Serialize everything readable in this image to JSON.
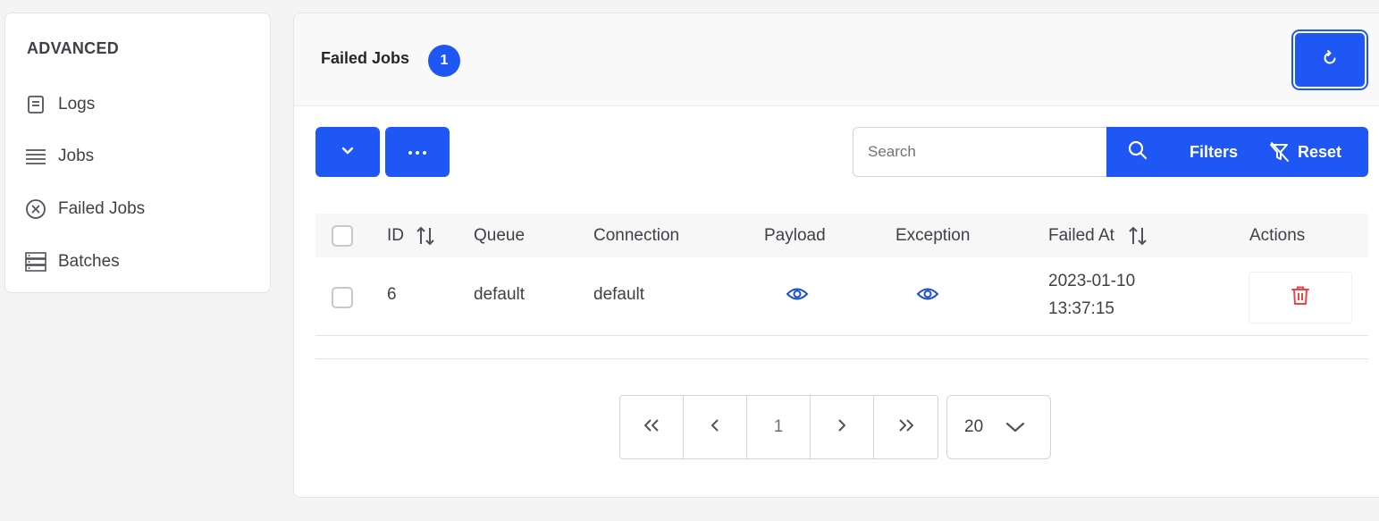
{
  "sidebar": {
    "title": "ADVANCED",
    "items": [
      {
        "label": "Logs",
        "icon": "document-icon"
      },
      {
        "label": "Jobs",
        "icon": "list-icon"
      },
      {
        "label": "Failed Jobs",
        "icon": "x-circle-icon"
      },
      {
        "label": "Batches",
        "icon": "server-stack-icon"
      }
    ]
  },
  "header": {
    "title": "Failed Jobs",
    "count": "1",
    "refresh_icon": "refresh-icon"
  },
  "toolbar": {
    "dropdown_icon": "chevron-down-icon",
    "more_icon": "ellipsis-icon",
    "search_placeholder": "Search",
    "search_value": "",
    "filters_label": "Filters",
    "reset_label": "Reset"
  },
  "table": {
    "columns": [
      "ID",
      "Queue",
      "Connection",
      "Payload",
      "Exception",
      "Failed At",
      "Actions"
    ],
    "rows": [
      {
        "id": "6",
        "queue": "default",
        "connection": "default",
        "failed_at_date": "2023-01-10",
        "failed_at_time": "13:37:15"
      }
    ]
  },
  "pagination": {
    "first": "«",
    "prev": "‹",
    "current_page": "1",
    "next": "›",
    "last": "»",
    "per_page": "20"
  },
  "colors": {
    "accent": "#1f57f5",
    "danger": "#ef4444",
    "icon_blue": "#1d4ed8"
  }
}
